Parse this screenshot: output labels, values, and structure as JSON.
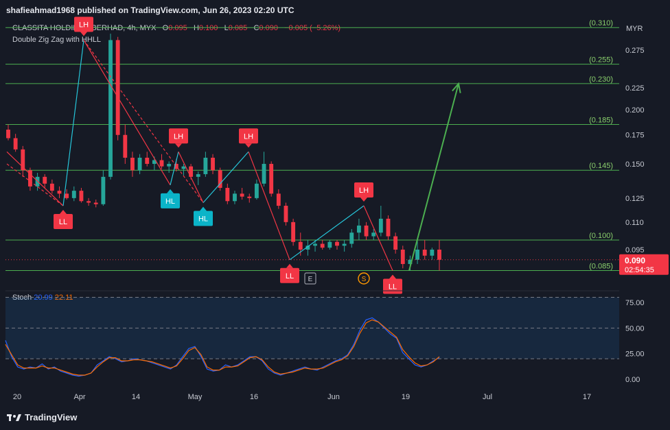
{
  "header": {
    "published": "shafieahmad1968 published on TradingView.com, Jun 26, 2023 02:20 UTC"
  },
  "legend": {
    "symbol": "CLASSITA HOLDINGS BERHAD, 4h, MYX",
    "o_label": "O",
    "o_value": "0.095",
    "h_label": "H",
    "h_value": "0.100",
    "l_label": "L",
    "l_value": "0.085",
    "c_label": "C",
    "c_value": "0.090",
    "change": "−0.005 (−5.26%)",
    "indicator": "Double Zig Zag with HHLL"
  },
  "stoch": {
    "label": "Stoch",
    "k_value": "20.99",
    "d_value": "22.11",
    "k_color": "#2962ff",
    "d_color": "#ff6d00"
  },
  "brand": {
    "name": "TradingView"
  },
  "colors": {
    "background": "#161a25",
    "up": "#26a69a",
    "down": "#f23645",
    "fib": "#4caf50",
    "arrow": "#4caf50",
    "zigzag_red": "#f23645",
    "zigzag_blue": "#26c6da"
  },
  "chart_data": [
    {
      "type": "candlestick",
      "currency_label": "MYX",
      "currency": "MYR",
      "timeframe": "4h",
      "y_axis_ticks": [
        0.095,
        0.11,
        0.125,
        0.15,
        0.175,
        0.2,
        0.225,
        0.275
      ],
      "y_axis_tick_labels": [
        "0.095",
        "0.110",
        "0.125",
        "0.150",
        "0.175",
        "0.200",
        "0.225",
        "0.275"
      ],
      "log_scale": true,
      "x_axis_labels": [
        "20",
        "Apr",
        "14",
        "May",
        "16",
        "Jun",
        "19",
        "Jul",
        "17"
      ],
      "last_price": "0.090",
      "countdown": "02:54:35",
      "fib_levels": [
        {
          "value": 0.31,
          "label": "(0.310)"
        },
        {
          "value": 0.255,
          "label": "(0.255)"
        },
        {
          "value": 0.23,
          "label": "(0.230)"
        },
        {
          "value": 0.185,
          "label": "(0.185)"
        },
        {
          "value": 0.145,
          "label": "(0.145)"
        },
        {
          "value": 0.1,
          "label": "(0.100)"
        },
        {
          "value": 0.085,
          "label": "(0.085)"
        }
      ],
      "pivots": [
        {
          "label": "LL",
          "kind": "low",
          "color": "red",
          "date": "Mar 31",
          "price": 0.12
        },
        {
          "label": "LH",
          "kind": "high",
          "color": "red",
          "date": "Apr 5",
          "price": 0.29
        },
        {
          "label": "HL",
          "kind": "low",
          "color": "blue",
          "date": "Apr 26",
          "price": 0.134
        },
        {
          "label": "LH",
          "kind": "high",
          "color": "red",
          "date": "Apr 28",
          "price": 0.16
        },
        {
          "label": "HL",
          "kind": "low",
          "color": "blue",
          "date": "May 4",
          "price": 0.122
        },
        {
          "label": "LH",
          "kind": "high",
          "color": "red",
          "date": "May 15",
          "price": 0.16
        },
        {
          "label": "LL",
          "kind": "low",
          "color": "red",
          "date": "May 25",
          "price": 0.09
        },
        {
          "label": "LH",
          "kind": "high",
          "color": "red",
          "date": "Jun 12",
          "price": 0.12
        },
        {
          "label": "LL",
          "kind": "low",
          "color": "red",
          "date": "Jun 19",
          "price": 0.085
        }
      ],
      "events": [
        {
          "label": "E",
          "date": "May 30"
        },
        {
          "label": "S",
          "date": "Jun 12"
        }
      ],
      "projection": {
        "from_date": "Jun 23",
        "from_price": 0.085,
        "to_date": "Jul 5",
        "to_price": 0.23
      },
      "candles": [
        {
          "o": 0.18,
          "h": 0.185,
          "l": 0.17,
          "c": 0.172
        },
        {
          "o": 0.172,
          "h": 0.176,
          "l": 0.16,
          "c": 0.162
        },
        {
          "o": 0.162,
          "h": 0.165,
          "l": 0.14,
          "c": 0.145
        },
        {
          "o": 0.145,
          "h": 0.147,
          "l": 0.13,
          "c": 0.133
        },
        {
          "o": 0.133,
          "h": 0.143,
          "l": 0.13,
          "c": 0.14
        },
        {
          "o": 0.14,
          "h": 0.142,
          "l": 0.132,
          "c": 0.135
        },
        {
          "o": 0.135,
          "h": 0.138,
          "l": 0.128,
          "c": 0.13
        },
        {
          "o": 0.13,
          "h": 0.133,
          "l": 0.125,
          "c": 0.128
        },
        {
          "o": 0.128,
          "h": 0.131,
          "l": 0.124,
          "c": 0.125
        },
        {
          "o": 0.125,
          "h": 0.133,
          "l": 0.123,
          "c": 0.13
        },
        {
          "o": 0.13,
          "h": 0.132,
          "l": 0.122,
          "c": 0.123
        },
        {
          "o": 0.123,
          "h": 0.125,
          "l": 0.12,
          "c": 0.122
        },
        {
          "o": 0.122,
          "h": 0.124,
          "l": 0.119,
          "c": 0.121
        },
        {
          "o": 0.121,
          "h": 0.145,
          "l": 0.12,
          "c": 0.14
        },
        {
          "o": 0.14,
          "h": 0.3,
          "l": 0.138,
          "c": 0.29
        },
        {
          "o": 0.29,
          "h": 0.295,
          "l": 0.17,
          "c": 0.175
        },
        {
          "o": 0.175,
          "h": 0.185,
          "l": 0.15,
          "c": 0.155
        },
        {
          "o": 0.155,
          "h": 0.16,
          "l": 0.14,
          "c": 0.145
        },
        {
          "o": 0.145,
          "h": 0.158,
          "l": 0.142,
          "c": 0.155
        },
        {
          "o": 0.155,
          "h": 0.16,
          "l": 0.148,
          "c": 0.15
        },
        {
          "o": 0.15,
          "h": 0.156,
          "l": 0.145,
          "c": 0.153
        },
        {
          "o": 0.153,
          "h": 0.158,
          "l": 0.146,
          "c": 0.148
        },
        {
          "o": 0.148,
          "h": 0.152,
          "l": 0.143,
          "c": 0.15
        },
        {
          "o": 0.15,
          "h": 0.154,
          "l": 0.144,
          "c": 0.146
        },
        {
          "o": 0.146,
          "h": 0.15,
          "l": 0.141,
          "c": 0.148
        },
        {
          "o": 0.148,
          "h": 0.15,
          "l": 0.138,
          "c": 0.14
        },
        {
          "o": 0.14,
          "h": 0.144,
          "l": 0.134,
          "c": 0.142
        },
        {
          "o": 0.142,
          "h": 0.16,
          "l": 0.14,
          "c": 0.155
        },
        {
          "o": 0.155,
          "h": 0.158,
          "l": 0.142,
          "c": 0.145
        },
        {
          "o": 0.145,
          "h": 0.147,
          "l": 0.13,
          "c": 0.132
        },
        {
          "o": 0.132,
          "h": 0.135,
          "l": 0.121,
          "c": 0.123
        },
        {
          "o": 0.123,
          "h": 0.13,
          "l": 0.121,
          "c": 0.128
        },
        {
          "o": 0.128,
          "h": 0.132,
          "l": 0.124,
          "c": 0.126
        },
        {
          "o": 0.126,
          "h": 0.128,
          "l": 0.122,
          "c": 0.125
        },
        {
          "o": 0.125,
          "h": 0.138,
          "l": 0.124,
          "c": 0.135
        },
        {
          "o": 0.135,
          "h": 0.16,
          "l": 0.133,
          "c": 0.15
        },
        {
          "o": 0.15,
          "h": 0.152,
          "l": 0.126,
          "c": 0.128
        },
        {
          "o": 0.128,
          "h": 0.131,
          "l": 0.118,
          "c": 0.12
        },
        {
          "o": 0.12,
          "h": 0.122,
          "l": 0.108,
          "c": 0.11
        },
        {
          "o": 0.11,
          "h": 0.112,
          "l": 0.097,
          "c": 0.099
        },
        {
          "o": 0.099,
          "h": 0.104,
          "l": 0.092,
          "c": 0.095
        },
        {
          "o": 0.095,
          "h": 0.1,
          "l": 0.092,
          "c": 0.097
        },
        {
          "o": 0.097,
          "h": 0.1,
          "l": 0.094,
          "c": 0.098
        },
        {
          "o": 0.098,
          "h": 0.1,
          "l": 0.095,
          "c": 0.096
        },
        {
          "o": 0.096,
          "h": 0.1,
          "l": 0.095,
          "c": 0.099
        },
        {
          "o": 0.099,
          "h": 0.1,
          "l": 0.095,
          "c": 0.097
        },
        {
          "o": 0.097,
          "h": 0.1,
          "l": 0.094,
          "c": 0.098
        },
        {
          "o": 0.098,
          "h": 0.106,
          "l": 0.096,
          "c": 0.104
        },
        {
          "o": 0.104,
          "h": 0.112,
          "l": 0.1,
          "c": 0.108
        },
        {
          "o": 0.108,
          "h": 0.11,
          "l": 0.1,
          "c": 0.102
        },
        {
          "o": 0.102,
          "h": 0.106,
          "l": 0.1,
          "c": 0.104
        },
        {
          "o": 0.104,
          "h": 0.12,
          "l": 0.102,
          "c": 0.112
        },
        {
          "o": 0.112,
          "h": 0.114,
          "l": 0.1,
          "c": 0.102
        },
        {
          "o": 0.102,
          "h": 0.104,
          "l": 0.093,
          "c": 0.095
        },
        {
          "o": 0.095,
          "h": 0.097,
          "l": 0.086,
          "c": 0.088
        },
        {
          "o": 0.088,
          "h": 0.092,
          "l": 0.085,
          "c": 0.09
        },
        {
          "o": 0.09,
          "h": 0.1,
          "l": 0.088,
          "c": 0.095
        },
        {
          "o": 0.095,
          "h": 0.1,
          "l": 0.09,
          "c": 0.092
        },
        {
          "o": 0.092,
          "h": 0.096,
          "l": 0.09,
          "c": 0.095
        },
        {
          "o": 0.095,
          "h": 0.1,
          "l": 0.085,
          "c": 0.09
        }
      ]
    },
    {
      "type": "line",
      "name": "Stoch",
      "y_axis_ticks": [
        0,
        25,
        50,
        75
      ],
      "y_axis_tick_labels": [
        "0.00",
        "25.00",
        "50.00",
        "75.00"
      ],
      "upper_band": 80,
      "middle_band": 50,
      "lower_band": 20,
      "series": [
        {
          "name": "K",
          "values": [
            38,
            22,
            12,
            10,
            12,
            11,
            15,
            10,
            12,
            8,
            6,
            4,
            3,
            4,
            6,
            14,
            18,
            22,
            20,
            17,
            18,
            20,
            19,
            18,
            16,
            14,
            12,
            10,
            14,
            22,
            30,
            32,
            22,
            10,
            8,
            9,
            14,
            12,
            14,
            18,
            22,
            22,
            18,
            10,
            6,
            4,
            6,
            8,
            10,
            12,
            10,
            9,
            12,
            15,
            18,
            20,
            24,
            34,
            48,
            58,
            60,
            56,
            50,
            44,
            40,
            26,
            20,
            14,
            12,
            14,
            18,
            21
          ]
        },
        {
          "name": "D",
          "values": [
            34,
            24,
            14,
            11,
            11,
            11,
            13,
            11,
            11,
            9,
            7,
            5,
            4,
            4,
            6,
            12,
            17,
            21,
            21,
            18,
            18,
            19,
            19,
            18,
            17,
            15,
            13,
            11,
            13,
            20,
            28,
            31,
            24,
            12,
            9,
            9,
            12,
            12,
            13,
            17,
            21,
            22,
            19,
            12,
            7,
            5,
            6,
            7,
            9,
            11,
            10,
            10,
            11,
            14,
            17,
            19,
            23,
            32,
            45,
            55,
            58,
            56,
            51,
            46,
            41,
            29,
            22,
            16,
            13,
            14,
            17,
            22
          ]
        }
      ]
    }
  ]
}
